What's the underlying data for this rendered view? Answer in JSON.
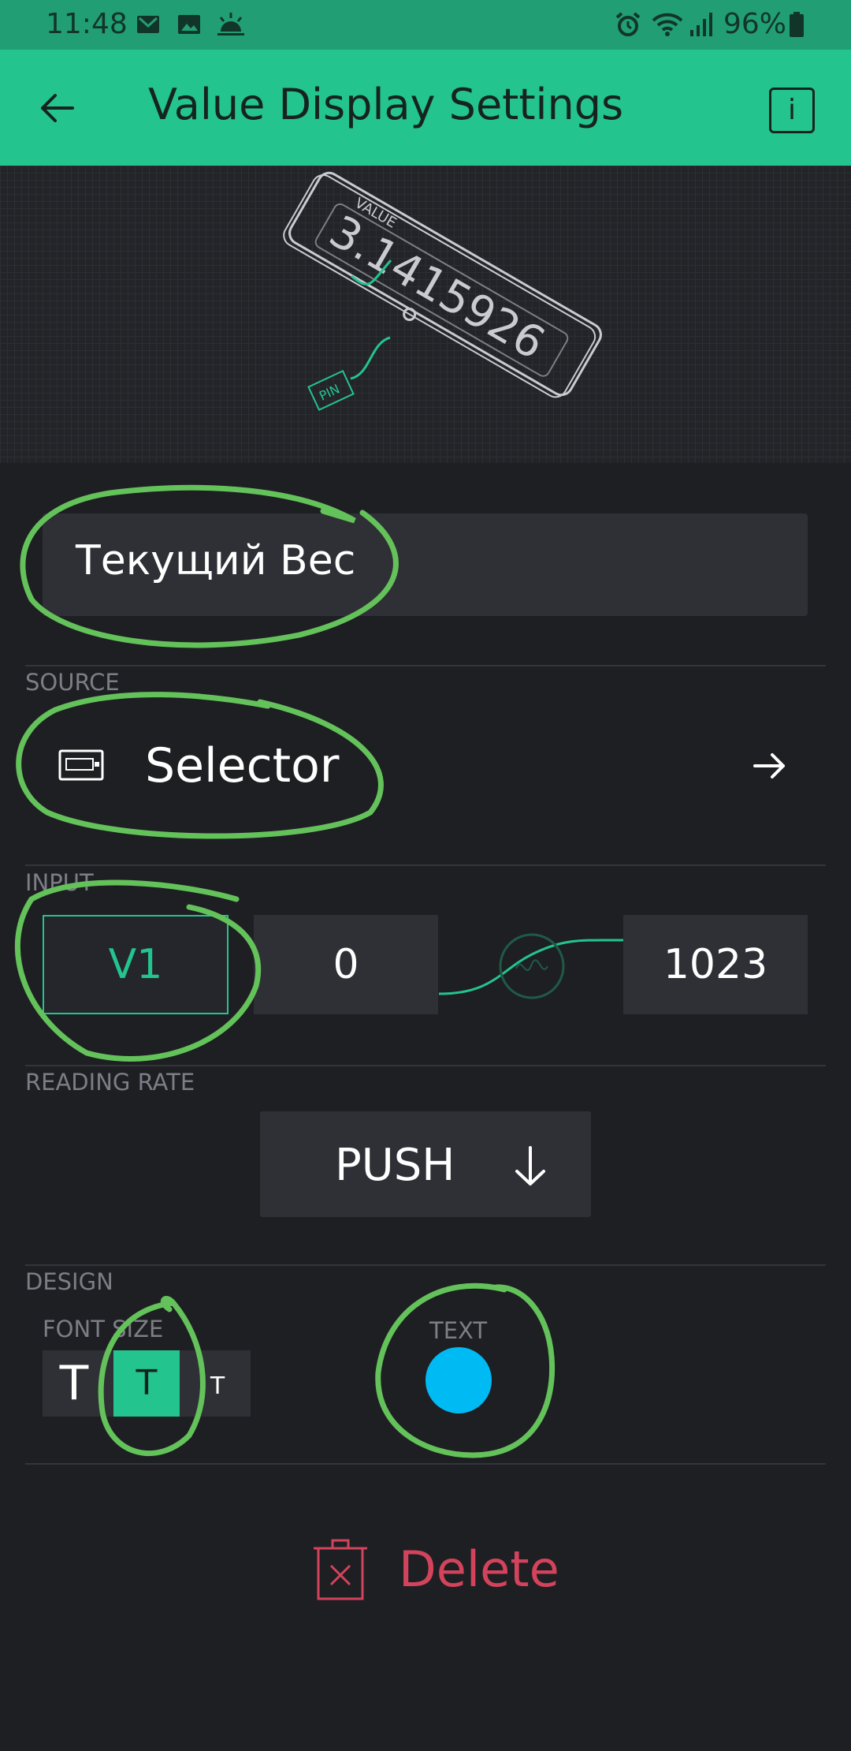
{
  "status_bar": {
    "time": "11:48",
    "battery": "96%",
    "icons": [
      "gmail-icon",
      "image-icon",
      "weather-icon",
      "alarm-icon",
      "wifi-icon",
      "signal-icon",
      "battery-icon"
    ]
  },
  "app_bar": {
    "title": "Value Display Settings",
    "back_icon": "arrow-left-icon",
    "info_label": "i"
  },
  "preview": {
    "illustration": "value-display-widget-illustration",
    "widget_label": "VALUE",
    "widget_value": "3.1415926",
    "pin_label": "PIN"
  },
  "widget_name": "Текущий Вес",
  "source": {
    "label": "SOURCE",
    "value": "Selector",
    "icon": "device-icon"
  },
  "input": {
    "label": "INPUT",
    "pin": "V1",
    "min": "0",
    "max": "1023"
  },
  "reading_rate": {
    "label": "READING RATE",
    "value": "PUSH"
  },
  "design": {
    "label": "DESIGN",
    "font_size_label": "FONT SIZE",
    "font_options": [
      "T",
      "T",
      "T"
    ],
    "font_selected_index": 1,
    "text_label": "TEXT",
    "text_color": "#00baf3"
  },
  "delete_label": "Delete",
  "colors": {
    "accent": "#23c48e",
    "background": "#1e1f23",
    "field": "#2f3035",
    "danger": "#d3435c",
    "annotation": "#64c25a"
  }
}
